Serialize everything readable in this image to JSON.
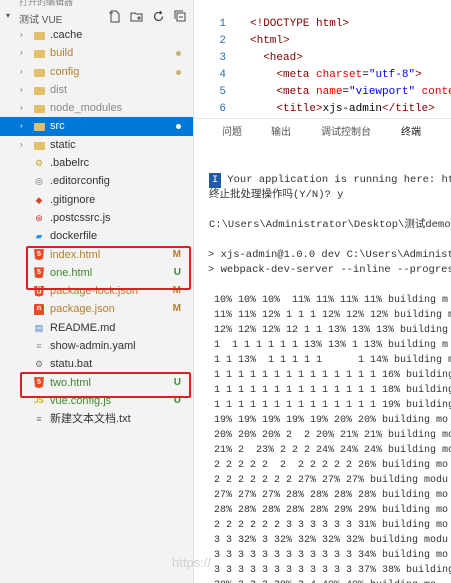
{
  "sidebar": {
    "opened_editors_label": "打开的编辑器",
    "project_name": "测试 VUE",
    "header_icons": [
      "new-file-icon",
      "new-folder-icon",
      "refresh-icon",
      "collapse-icon"
    ],
    "items": [
      {
        "label": ".cache",
        "type": "folder"
      },
      {
        "label": "build",
        "type": "folder",
        "dot": true
      },
      {
        "label": "config",
        "type": "folder",
        "dot": true
      },
      {
        "label": "dist",
        "type": "folder"
      },
      {
        "label": "node_modules",
        "type": "folder"
      },
      {
        "label": "src",
        "type": "folder",
        "selected": true,
        "dot": true
      },
      {
        "label": "static",
        "type": "folder"
      },
      {
        "label": ".babelrc",
        "type": "file"
      },
      {
        "label": ".editorconfig",
        "type": "file"
      },
      {
        "label": ".gitignore",
        "type": "file"
      },
      {
        "label": ".postcssrc.js",
        "type": "file"
      },
      {
        "label": "dockerfile",
        "type": "file"
      },
      {
        "label": "index.html",
        "type": "html",
        "badge": "M"
      },
      {
        "label": "one.html",
        "type": "html",
        "badge": "U"
      },
      {
        "label": "package-lock.json",
        "type": "json",
        "badge": "M"
      },
      {
        "label": "package.json",
        "type": "json",
        "badge": "M"
      },
      {
        "label": "README.md",
        "type": "file"
      },
      {
        "label": "show-admin.yaml",
        "type": "file"
      },
      {
        "label": "statu.bat",
        "type": "file"
      },
      {
        "label": "two.html",
        "type": "html",
        "badge": "U"
      },
      {
        "label": "vue.config.js",
        "type": "js",
        "badge": "U"
      },
      {
        "label": "新建文本文档.txt",
        "type": "file"
      }
    ]
  },
  "editor": {
    "lines": [
      {
        "num": "1",
        "parts": [
          [
            "tag",
            "<!DOCTYPE html>"
          ]
        ]
      },
      {
        "num": "2",
        "parts": [
          [
            "tag",
            "<html>"
          ]
        ]
      },
      {
        "num": "3",
        "parts": [
          [
            "tag",
            "  <head>"
          ]
        ]
      },
      {
        "num": "4",
        "parts": [
          [
            "tag",
            "    <meta "
          ],
          [
            "attr",
            "charset"
          ],
          [
            "plain",
            "="
          ],
          [
            "str",
            "\"utf-8\""
          ],
          [
            "tag",
            ">"
          ]
        ]
      },
      {
        "num": "5",
        "parts": [
          [
            "tag",
            "    <meta "
          ],
          [
            "attr",
            "name"
          ],
          [
            "plain",
            "="
          ],
          [
            "str",
            "\"viewport\""
          ],
          [
            "attr",
            " conter"
          ]
        ]
      },
      {
        "num": "6",
        "parts": [
          [
            "tag",
            "    <title>"
          ],
          [
            "plain",
            "xjs-admin"
          ],
          [
            "tag",
            "</title>"
          ]
        ]
      }
    ]
  },
  "panel": {
    "tabs": [
      "问题",
      "输出",
      "调试控制台",
      "终端"
    ],
    "active_tab": "终端"
  },
  "terminal": {
    "cursor_char": "I",
    "running_line": " Your application is running here: htt",
    "terminate_prompt": "终止批处理操作吗(Y/N)? y",
    "path_line": "C:\\Users\\Administrator\\Desktop\\测试demo\\测",
    "cmd1": "> xjs-admin@1.0.0 dev C:\\Users\\Administrat",
    "cmd2": "> webpack-dev-server --inline --progress",
    "progress": [
      "10% 10% 10%  11% 11% 11% 11% building m",
      "11% 11% 12% 1 1 1 12% 12% 12% building m",
      "12% 12% 12% 12 1 1 13% 13% 13% building m",
      "1  1 1 1 1 1 1 13% 13% 1 13% building m",
      "1 1 13%  1 1 1 1 1      1 14% building m",
      "1 1 1 1 1 1 1 1 1 1 1 1 1 1 16% building m",
      "1 1 1 1 1 1 1 1 1 1 1 1 1 1 18% building m",
      "1 1 1 1 1 1 1 1 1 1 1 1 1 1 19% building m",
      "19% 19% 19% 19% 19% 20% 20% building mo",
      "20% 20% 20% 2  2 20% 21% 21% building mo",
      "21% 2  23% 2 2 2 24% 24% 24% building mo",
      "2 2 2 2 2  2  2 2 2 2 2 26% building mo",
      "2 2 2 2 2 2 2 27% 27% 27% building modu",
      "27% 27% 27% 28% 28% 28% 28% building mo",
      "28% 28% 28% 28% 28% 29% 29% building mo",
      "2 2 2 2 2 2 3 3 3 3 3 3 31% building mo",
      "3 3 32% 3 32% 32% 32% 32% building modu",
      "3 3 3 3 3 3 3 3 3 3 3 3 34% building mo",
      "3 3 3 3 3 3 3 3 3 3 3 3 37% 38% building mo",
      "38% 3 3 3 38% 3 4 40% 40% building mo"
    ]
  },
  "watermark": "https://"
}
